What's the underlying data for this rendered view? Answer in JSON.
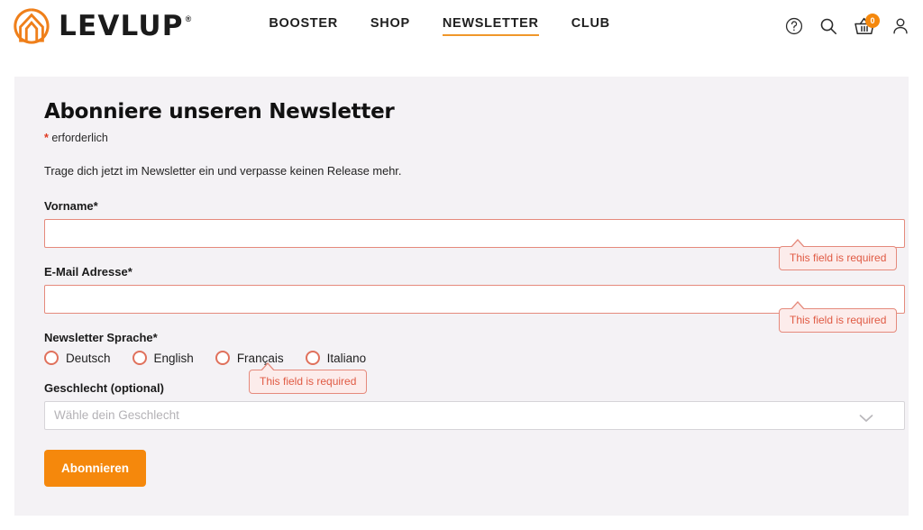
{
  "header": {
    "logo": {
      "mark_icon": "levlup-arrow-logo-icon",
      "wordmark": "LEVLUP",
      "registered_mark": "®"
    },
    "nav": [
      {
        "label": "BOOSTER",
        "active": false
      },
      {
        "label": "SHOP",
        "active": false
      },
      {
        "label": "NEWSLETTER",
        "active": true
      },
      {
        "label": "CLUB",
        "active": false
      }
    ],
    "icons": {
      "help": "help-circle-icon",
      "search": "search-icon",
      "cart": "shopping-basket-icon",
      "cart_badge_count": "0",
      "account": "user-account-icon"
    }
  },
  "main": {
    "title": "Abonniere unseren Newsletter",
    "required_star": "*",
    "required_note": "erforderlich",
    "intro": "Trage dich jetzt im Newsletter ein und verpasse keinen Release mehr.",
    "fields": {
      "first_name": {
        "label": "Vorname*",
        "value": "",
        "placeholder": "",
        "error": "This field is required"
      },
      "email": {
        "label": "E-Mail Adresse*",
        "value": "",
        "placeholder": "",
        "error": "This field is required"
      },
      "language": {
        "label": "Newsletter Sprache*",
        "error": "This field is required",
        "options": [
          {
            "label": "Deutsch",
            "selected": false
          },
          {
            "label": "English",
            "selected": false
          },
          {
            "label": "Français",
            "selected": false
          },
          {
            "label": "Italiano",
            "selected": false
          }
        ]
      },
      "gender": {
        "label": "Geschlecht (optional)",
        "placeholder": "Wähle dein Geschlecht",
        "value": "",
        "chevron_icon": "chevron-down-icon"
      }
    },
    "submit_label": "Abonnieren"
  },
  "colors": {
    "brand_orange": "#f5880c",
    "accent_underline": "#f0972a",
    "error_border": "#e58a7c",
    "error_text": "#e05a43",
    "error_bg": "#fceceb",
    "panel_bg": "#f4f2f5"
  }
}
